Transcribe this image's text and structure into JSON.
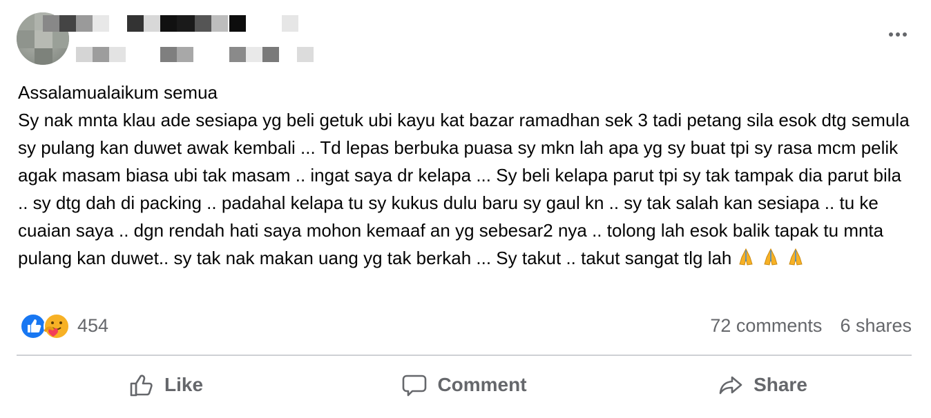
{
  "header": {
    "author_name_redacted": true,
    "more_icon": "more-horizontal-icon"
  },
  "post": {
    "text": "Assalamualaikum semua\nSy nak mnta klau ade sesiapa yg beli getuk ubi kayu kat bazar ramadhan sek 3 tadi petang sila esok dtg semula sy pulang kan duwet awak kembali ... Td lepas berbuka puasa sy mkn lah apa yg sy buat tpi sy rasa mcm pelik agak masam biasa ubi tak masam .. ingat saya dr kelapa ... Sy beli kelapa parut tpi sy tak tampak dia parut bila .. sy dtg dah di packing .. padahal kelapa tu sy kukus dulu baru sy gaul kn .. sy tak salah kan sesiapa .. tu ke cuaian saya .. dgn rendah hati saya mohon kemaaf an yg sebesar2 nya .. tolong lah esok balik tapak tu mnta pulang kan duwet.. sy tak nak makan uang yg tak berkah ... Sy takut .. takut sangat tlg lah",
    "emoji": "🙏🙏🙏"
  },
  "reactions": {
    "icons": [
      "like-reaction-icon",
      "care-reaction-icon"
    ],
    "count": "454",
    "comments": "72 comments",
    "shares": "6 shares"
  },
  "actions": {
    "like": "Like",
    "comment": "Comment",
    "share": "Share"
  },
  "colors": {
    "like_blue": "#1877f2",
    "care_yellow": "#f7b125",
    "care_red": "#f33e58",
    "muted_text": "#65676b",
    "divider": "#ced0d4"
  }
}
